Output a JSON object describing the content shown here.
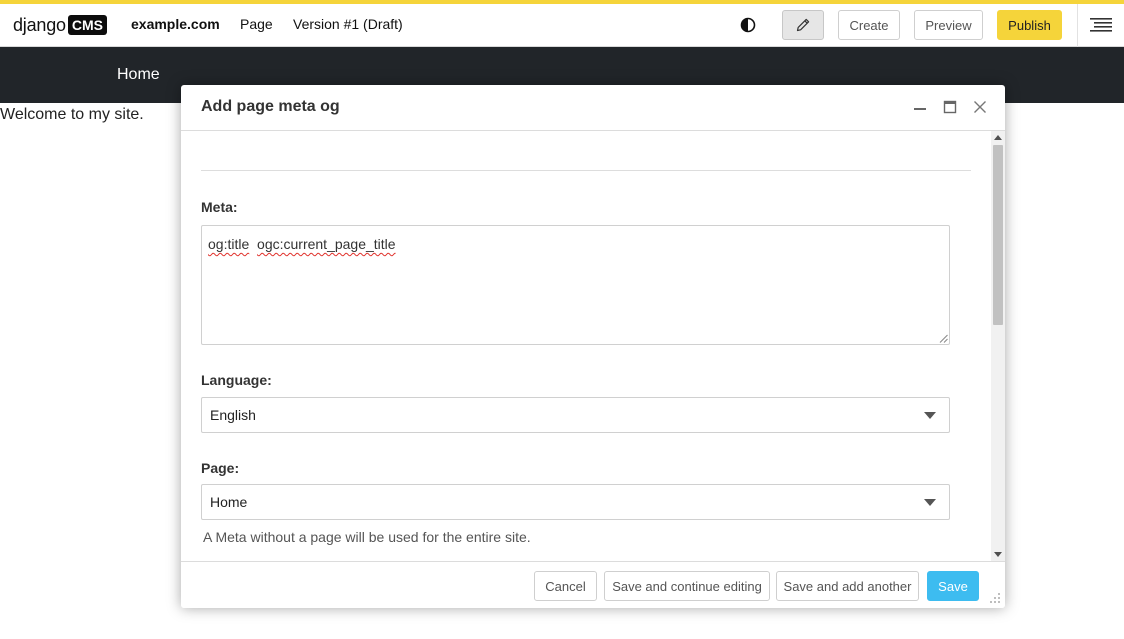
{
  "toolbar": {
    "logo_word": "django",
    "logo_badge": "CMS",
    "site_name": "example.com",
    "page_menu": "Page",
    "version_menu": "Version #1 (Draft)",
    "create_label": "Create",
    "preview_label": "Preview",
    "publish_label": "Publish",
    "accent_color": "#f5d43a",
    "icons": [
      "contrast-icon",
      "pencil-icon",
      "hamburger-menu-icon"
    ]
  },
  "site": {
    "nav_home": "Home",
    "welcome_text": "Welcome to my site."
  },
  "modal": {
    "title": "Add page meta og",
    "header_icons": [
      "minimize-icon",
      "maximize-icon",
      "close-icon"
    ],
    "meta_label": "Meta:",
    "meta_value_prop": "og:title",
    "meta_value_sep": "  ",
    "meta_value_content": "ogc:current_page_title",
    "language_label": "Language:",
    "language_value": "English",
    "page_label": "Page:",
    "page_value": "Home",
    "page_help": "A Meta without a page will be used for the entire site."
  },
  "footer": {
    "cancel_label": "Cancel",
    "continue_label": "Save and continue editing",
    "another_label": "Save and add another",
    "save_label": "Save",
    "save_color": "#3dbcf0"
  }
}
